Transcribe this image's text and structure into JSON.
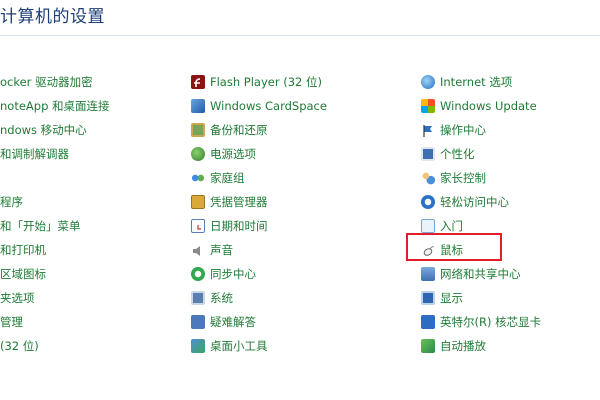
{
  "window": {
    "title": "计算机的设置"
  },
  "columns": {
    "left": [
      {
        "label": "ocker 驱动器加密"
      },
      {
        "label": "noteApp 和桌面连接"
      },
      {
        "label": "ndows 移动中心"
      },
      {
        "label": "和调制解调器"
      },
      {
        "label": ""
      },
      {
        "label": "程序"
      },
      {
        "label": "和「开始」菜单"
      },
      {
        "label": "和打印机"
      },
      {
        "label": "区域图标"
      },
      {
        "label": "夹选项"
      },
      {
        "label": "管理"
      },
      {
        "label": "(32 位)"
      }
    ],
    "middle": [
      {
        "label": "Flash Player (32 位)",
        "icon": "flash-icon"
      },
      {
        "label": "Windows CardSpace",
        "icon": "cardspace-icon"
      },
      {
        "label": "备份和还原",
        "icon": "backup-icon"
      },
      {
        "label": "电源选项",
        "icon": "power-icon"
      },
      {
        "label": "家庭组",
        "icon": "homegroup-icon"
      },
      {
        "label": "凭据管理器",
        "icon": "credential-icon"
      },
      {
        "label": "日期和时间",
        "icon": "clock-icon"
      },
      {
        "label": "声音",
        "icon": "speaker-icon"
      },
      {
        "label": "同步中心",
        "icon": "sync-icon"
      },
      {
        "label": "系统",
        "icon": "system-icon"
      },
      {
        "label": "疑难解答",
        "icon": "troubleshoot-icon"
      },
      {
        "label": "桌面小工具",
        "icon": "gadget-icon"
      }
    ],
    "right": [
      {
        "label": "Internet 选项",
        "icon": "internet-icon"
      },
      {
        "label": "Windows Update",
        "icon": "update-icon"
      },
      {
        "label": "操作中心",
        "icon": "flag-icon"
      },
      {
        "label": "个性化",
        "icon": "personalize-icon"
      },
      {
        "label": "家长控制",
        "icon": "parental-icon"
      },
      {
        "label": "轻松访问中心",
        "icon": "ease-access-icon"
      },
      {
        "label": "入门",
        "icon": "getting-started-icon"
      },
      {
        "label": "鼠标",
        "icon": "mouse-icon"
      },
      {
        "label": "网络和共享中心",
        "icon": "network-icon"
      },
      {
        "label": "显示",
        "icon": "display-icon"
      },
      {
        "label": "英特尔(R) 核芯显卡",
        "icon": "intel-icon"
      },
      {
        "label": "自动播放",
        "icon": "autoplay-icon"
      }
    ]
  },
  "highlight": {
    "item": "鼠标",
    "color": "#e21f26"
  }
}
